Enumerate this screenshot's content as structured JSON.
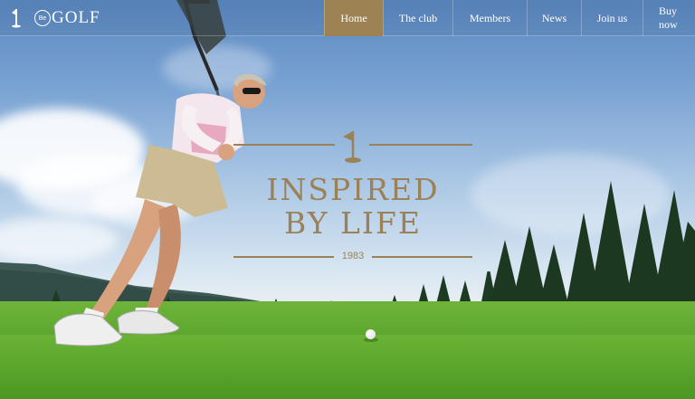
{
  "brand": {
    "badge": "Be",
    "name": "GOLF"
  },
  "nav": {
    "items": [
      {
        "label": "Home",
        "active": true
      },
      {
        "label": "The club",
        "active": false
      },
      {
        "label": "Members",
        "active": false
      },
      {
        "label": "News",
        "active": false
      },
      {
        "label": "Join us",
        "active": false
      },
      {
        "label": "Buy now",
        "active": false
      }
    ]
  },
  "hero": {
    "headline_line1": "INSPIRED",
    "headline_line2": "BY LIFE",
    "year": "1983"
  },
  "colors": {
    "accent": "#9d8354",
    "text_on_nav": "#ffffff"
  },
  "icons": [
    "golf-flag-icon",
    "logo-flag-icon"
  ]
}
